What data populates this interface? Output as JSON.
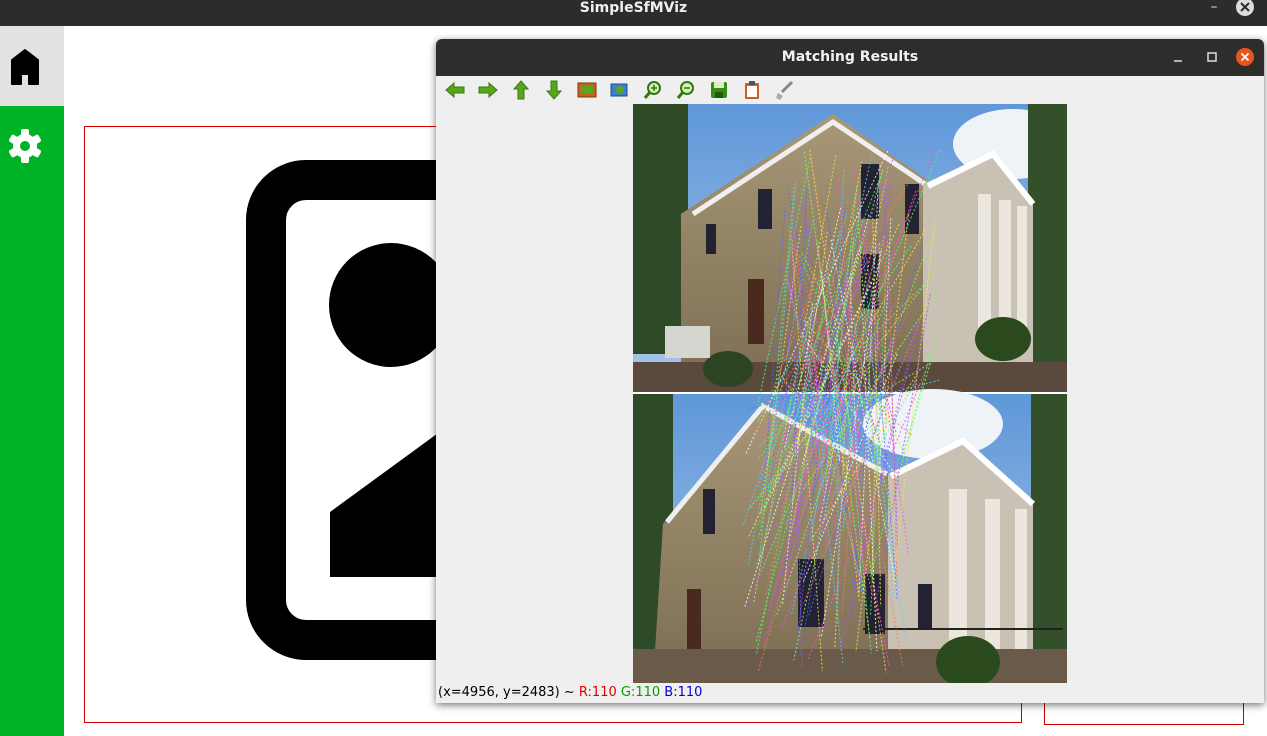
{
  "app": {
    "title": "SimpleSfMViz"
  },
  "sidebar": {
    "items": [
      {
        "icon": "home-icon"
      },
      {
        "icon": "gear-icon"
      }
    ]
  },
  "dialog": {
    "title": "Matching Results",
    "toolbar": [
      {
        "icon": "arrow-left-icon"
      },
      {
        "icon": "arrow-right-icon"
      },
      {
        "icon": "arrow-up-icon"
      },
      {
        "icon": "arrow-down-icon"
      },
      {
        "icon": "image-icon"
      },
      {
        "icon": "zoom-fit-icon"
      },
      {
        "icon": "zoom-in-icon"
      },
      {
        "icon": "zoom-out-icon"
      },
      {
        "icon": "save-icon"
      },
      {
        "icon": "clipboard-icon"
      },
      {
        "icon": "brush-icon"
      }
    ],
    "status": {
      "coords": "(x=4956, y=2483) ~ ",
      "r": "R:110",
      "g": "G:110",
      "b": "B:110"
    }
  },
  "colors": {
    "accent": "#00b225",
    "close_button": "#e95420",
    "frame_border": "#d40000"
  }
}
